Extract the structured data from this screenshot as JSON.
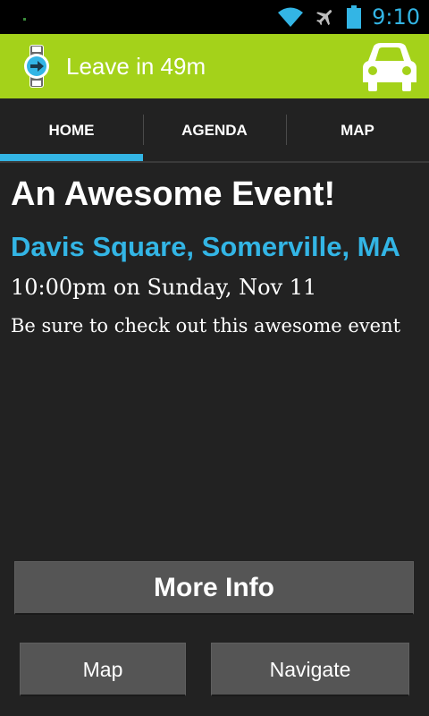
{
  "status_bar": {
    "time": "9:10",
    "icons": [
      "wifi-icon",
      "airplane-icon",
      "battery-icon"
    ],
    "accent": "#33b5e5"
  },
  "notification": {
    "text": "Leave in 49m",
    "icons": [
      "watch-icon",
      "car-icon"
    ],
    "background": "#a4d21a"
  },
  "tabs": [
    {
      "label": "HOME",
      "selected": true
    },
    {
      "label": "AGENDA",
      "selected": false
    },
    {
      "label": "MAP",
      "selected": false
    }
  ],
  "event": {
    "title": "An Awesome Event!",
    "location": "Davis Square, Somerville, MA",
    "datetime": "10:00pm on Sunday, Nov 11",
    "description": "Be sure to check out this awesome event"
  },
  "buttons": {
    "more_info": "More Info",
    "map": "Map",
    "navigate": "Navigate"
  }
}
